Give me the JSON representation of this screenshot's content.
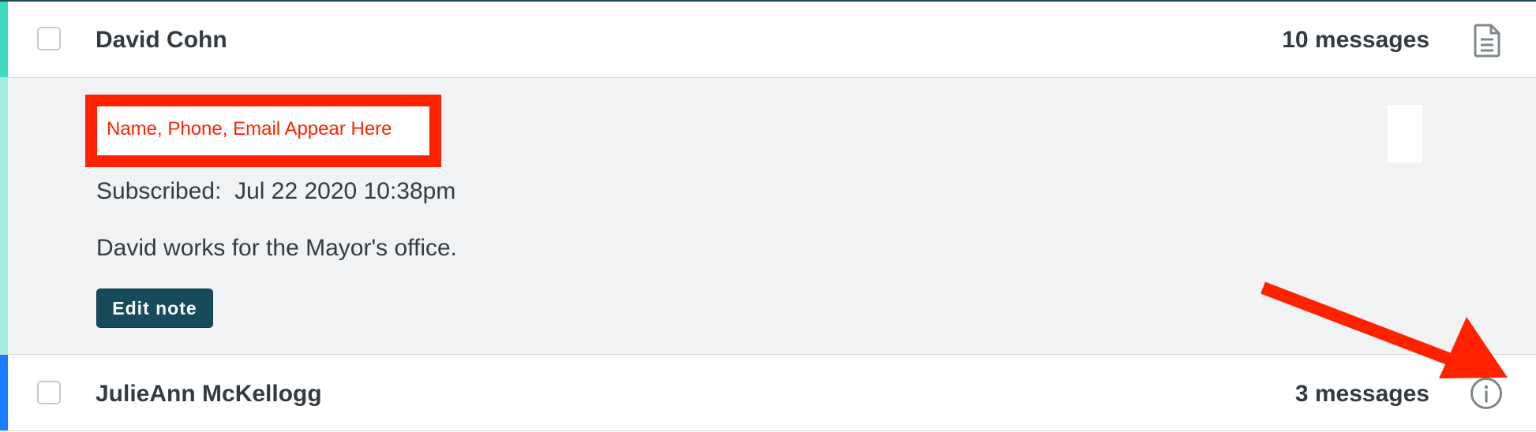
{
  "rows": [
    {
      "name": "David Cohn",
      "message_count": "10 messages",
      "icon": "document-icon",
      "accent_color": "#3fd8c0",
      "expanded": true
    },
    {
      "name": "JulieAnn McKellogg",
      "message_count": "3 messages",
      "icon": "info-icon",
      "accent_color": "#1a7cff",
      "expanded": false
    }
  ],
  "details": {
    "redaction_text": "Name, Phone, Email Appear Here",
    "subscribed_label": "Subscribed:",
    "subscribed_value": "Jul 22 2020 10:38pm",
    "note": "David works for the Mayor's office.",
    "edit_note_label": "Edit note"
  },
  "colors": {
    "annotation_red": "#ff2200",
    "button_bg": "#164b5c",
    "panel_bg": "#f1f2f4",
    "text": "#333b41"
  }
}
